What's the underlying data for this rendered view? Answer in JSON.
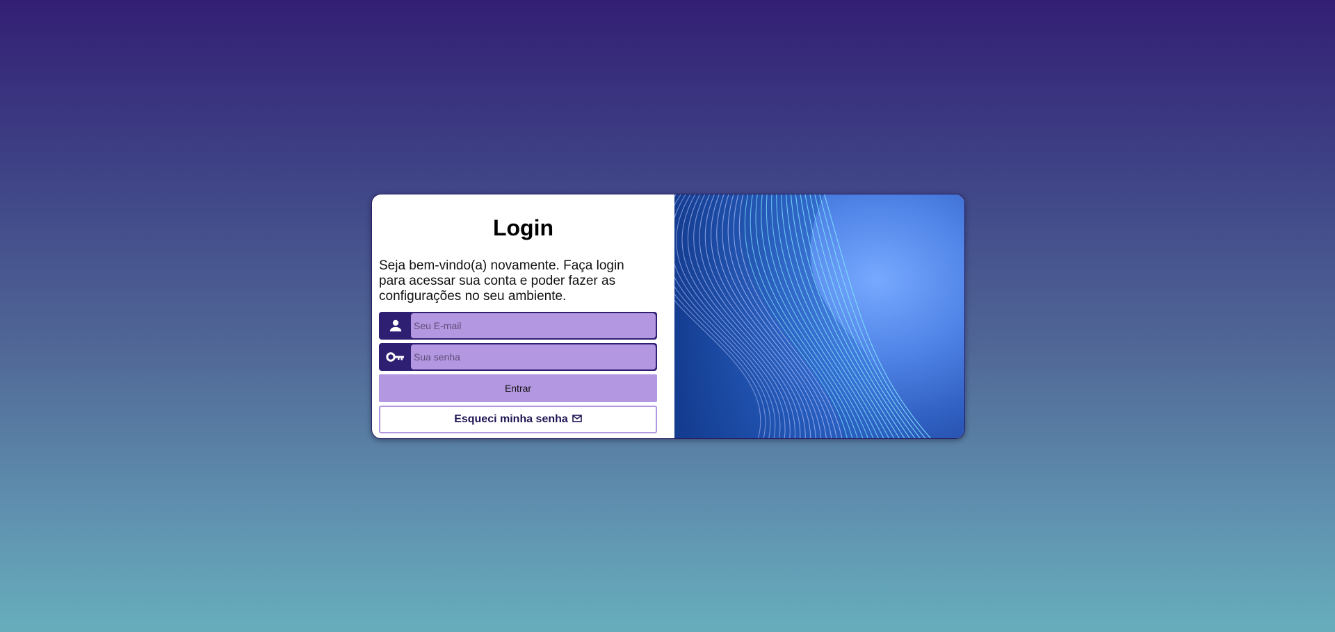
{
  "login": {
    "title": "Login",
    "welcome_text": "Seja bem-vindo(a) novamente. Faça login para acessar sua conta e poder fazer as configurações no seu ambiente.",
    "email_placeholder": "Seu E-mail",
    "email_value": "",
    "password_placeholder": "Sua senha",
    "password_value": "",
    "submit_label": "Entrar",
    "forgot_label": "Esqueci minha senha"
  },
  "icons": {
    "email_field": "user-icon",
    "password_field": "key-icon",
    "forgot_button": "mail-icon"
  },
  "colors": {
    "accent": "#b497e1",
    "primary_dark": "#2e1f72"
  }
}
